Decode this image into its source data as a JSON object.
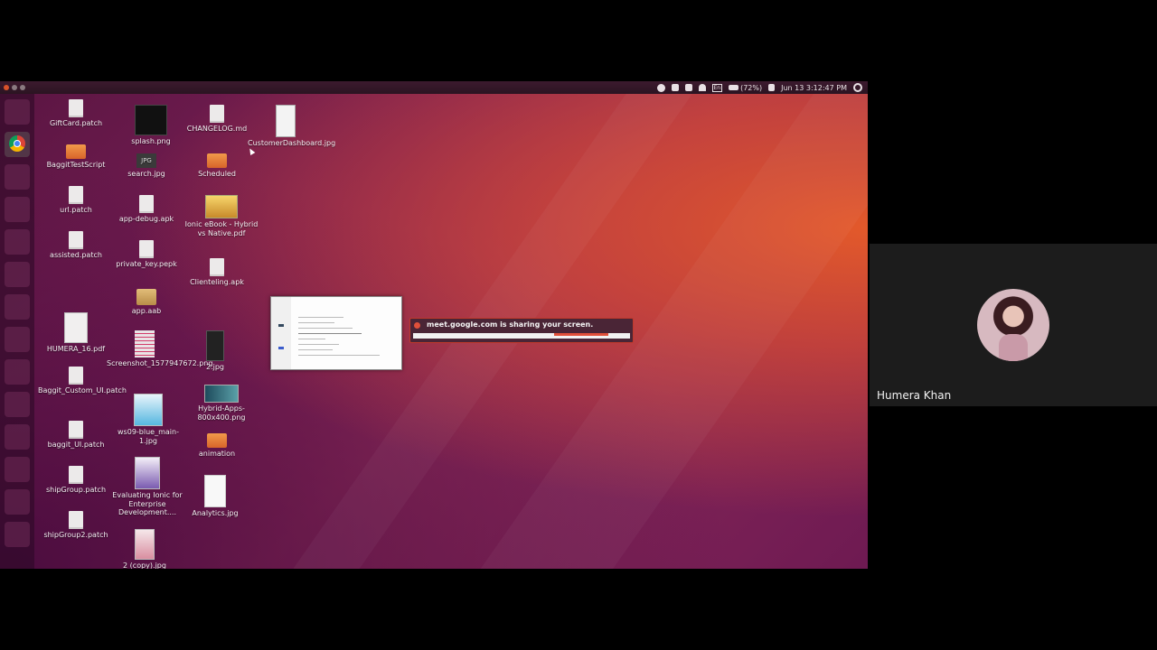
{
  "topbar": {
    "battery": "(72%)",
    "datetime": "Jun 13 3:12:47 PM",
    "keyboard": "En",
    "tray_icons": [
      "chrome-tray-icon",
      "dropbox-icon",
      "printer-icon",
      "wifi-icon",
      "keyboard-icon",
      "battery-icon",
      "volume-icon",
      "power-gear-icon"
    ]
  },
  "desktop_icons": {
    "c1": [
      "GiftCard.patch",
      "BaggitTestScript",
      "url.patch",
      "assisted.patch",
      "HUMERA_16.pdf",
      "Baggit_Custom_UI.patch",
      "baggit_UI.patch",
      "shipGroup.patch",
      "shipGroup2.patch"
    ],
    "c2": [
      "splash.png",
      "search.jpg",
      "app-debug.apk",
      "private_key.pepk",
      "app.aab",
      "Screenshot_1577947672.png",
      "ws09-blue_main-1.jpg",
      "Evaluating Ionic for Enterprise Development....",
      "2 (copy).jpg"
    ],
    "c3": [
      "CHANGELOG.md",
      "Scheduled",
      "Ionic eBook - Hybrid vs Native.pdf",
      "Clienteling.apk",
      "2.jpg",
      "Hybrid-Apps-800x400.png",
      "animation",
      "Analytics.jpg"
    ],
    "c4": [
      "CustomerDashboard.jpg"
    ],
    "jpg_tag": "JPG"
  },
  "notification": {
    "message": "meet.google.com is sharing your screen."
  },
  "participant": {
    "name": "Humera Khan"
  },
  "colors": {
    "accent": "#e0503a",
    "wallpaper_base": "#7a1f55",
    "wallpaper_glow": "#e85c28"
  }
}
